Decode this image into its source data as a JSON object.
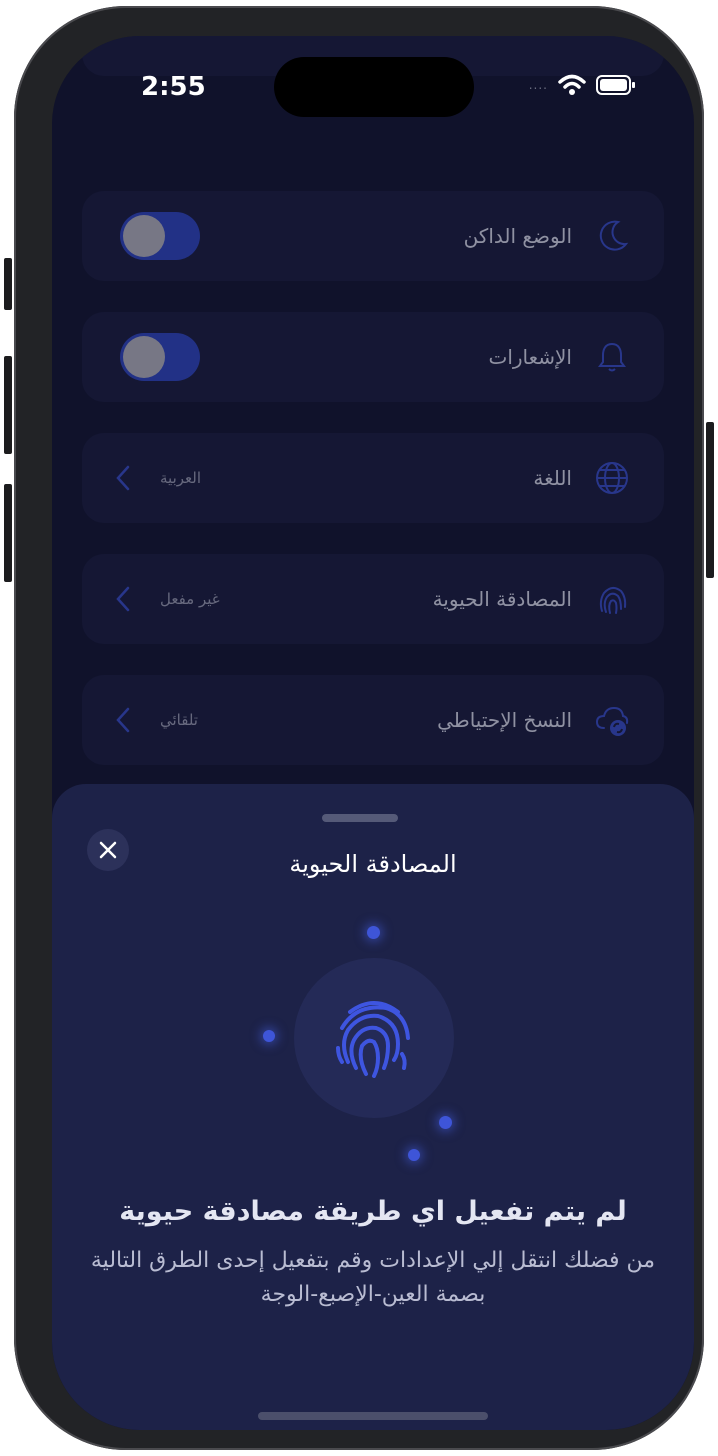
{
  "status_bar": {
    "time": "2:55",
    "signal_dots": "....",
    "wifi_icon": "wifi-icon",
    "battery_icon": "battery-icon"
  },
  "settings": {
    "dark_mode": {
      "label": "الوضع الداكن",
      "icon": "moon-icon",
      "enabled": true
    },
    "notifications": {
      "label": "الإشعارات",
      "icon": "bell-icon",
      "enabled": true
    },
    "language": {
      "label": "اللغة",
      "icon": "globe-icon",
      "value": "العربية"
    },
    "biometric": {
      "label": "المصادقة الحيوية",
      "icon": "fingerprint-icon",
      "value": "غير مفعل"
    },
    "backup": {
      "label": "النسخ الإحتياطي",
      "icon": "cloud-sync-icon",
      "value": "تلقائي"
    }
  },
  "sheet": {
    "title": "المصادقة الحيوية",
    "message_title": "لم يتم تفعيل اي طريقة مصادقة حيوية",
    "message_body_line1": "من فضلك انتقل إلي الإعدادات وقم بتفعيل إحدى الطرق التالية",
    "message_body_line2": "بصمة العين-الإصبع-الوجة"
  },
  "colors": {
    "background": "#141733",
    "row": "#1c2041",
    "sheet": "#1d2248",
    "accent": "#3048bf"
  }
}
